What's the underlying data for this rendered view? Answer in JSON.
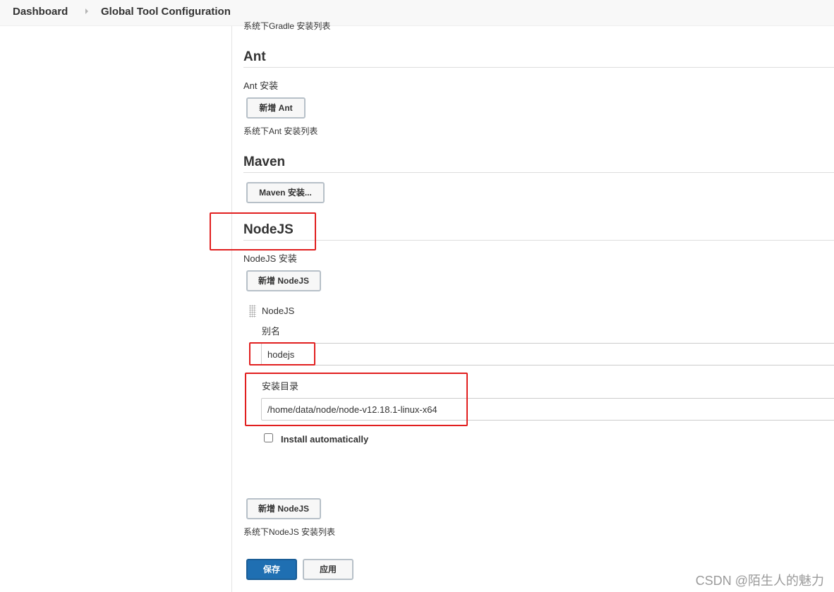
{
  "breadcrumb": {
    "items": [
      "Dashboard",
      "Global Tool Configuration"
    ]
  },
  "gradle": {
    "partial_description": "系统下Gradle 安装列表"
  },
  "ant": {
    "title": "Ant",
    "installations_label": "Ant 安装",
    "add_button": "新增 Ant",
    "description": "系统下Ant 安装列表"
  },
  "maven": {
    "title": "Maven",
    "installations_button": "Maven 安装..."
  },
  "nodejs": {
    "title": "NodeJS",
    "installations_label": "NodeJS 安装",
    "add_button_top": "新增 NodeJS",
    "installation": {
      "header": "NodeJS",
      "name_label": "别名",
      "name_value": "hodejs",
      "home_label": "安装目录",
      "home_value": "/home/data/node/node-v12.18.1-linux-x64",
      "install_auto_label": "Install automatically",
      "install_auto_checked": false
    },
    "add_button_bottom": "新增 NodeJS",
    "description": "系统下NodeJS 安装列表"
  },
  "actions": {
    "save": "保存",
    "apply": "应用"
  },
  "watermark": "CSDN @陌生人的魅力",
  "colors": {
    "accent_blue": "#1f6fb2",
    "annotation_red": "#e11f1f"
  }
}
